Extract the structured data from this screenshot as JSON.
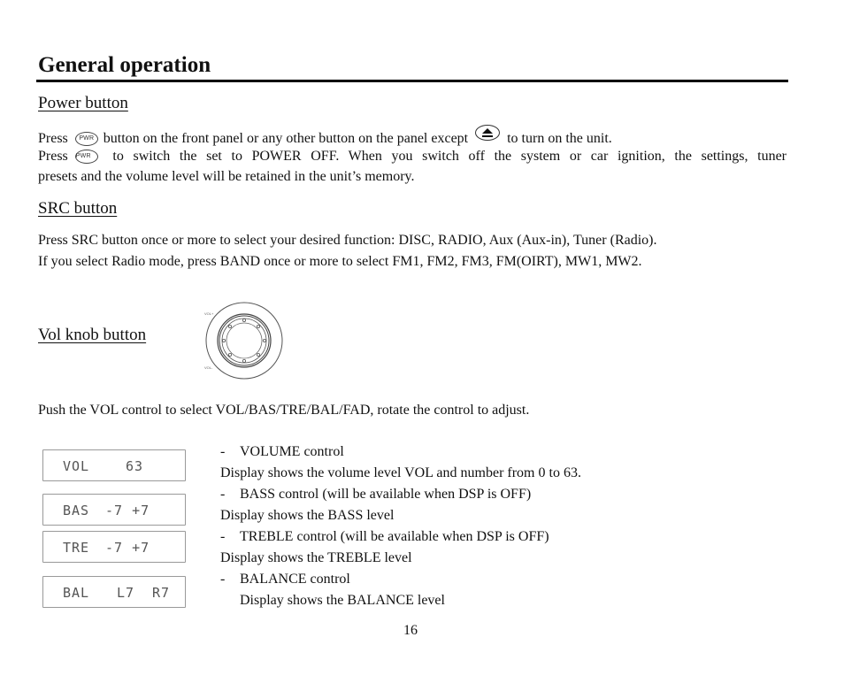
{
  "page": {
    "title": "General operation",
    "page_number": "16"
  },
  "power": {
    "heading": "Power button",
    "line1": {
      "pre": "Press",
      "icon1": "PWR",
      "mid": "button on the front panel or any other button on the panel except",
      "icon2": "eject-icon",
      "post": "to turn on the unit."
    },
    "line2": {
      "pre": "Press",
      "icon": "PWR",
      "post": "to switch the set to POWER OFF. When you switch off the system or car ignition, the settings, tuner"
    },
    "line3": "presets and the volume level will be retained in the unit’s memory."
  },
  "src": {
    "heading": "SRC button",
    "line1": "Press SRC button once or more to select your desired function: DISC, RADIO, Aux (Aux-in), Tuner (Radio).",
    "line2": "If you select Radio mode, press BAND once or more to select FM1, FM2, FM3, FM(OIRT), MW1, MW2."
  },
  "vol": {
    "heading": "Vol knob button",
    "knob_labels": {
      "top": "VOL+",
      "bottom": "VOL-"
    },
    "intro": "Push the VOL control to select VOL/BAS/TRE/BAL/FAD, rotate the control to adjust."
  },
  "displays": [
    {
      "label": "VOL",
      "value": "63"
    },
    {
      "label": "BAS",
      "value": "-7 +7"
    },
    {
      "label": "TRE",
      "value": "-7 +7"
    },
    {
      "label": "BAL",
      "value_left": "L7",
      "value_right": "R7"
    }
  ],
  "descriptions": [
    {
      "dash": "-",
      "text": "VOLUME control"
    },
    {
      "text": "Display shows the volume level VOL and number from 0 to 63."
    },
    {
      "dash": "-",
      "text": "BASS control (will be available when DSP is OFF)"
    },
    {
      "text": "Display shows the BASS level"
    },
    {
      "dash": "-",
      "text": "TREBLE control (will be available when DSP is OFF)"
    },
    {
      "text": "Display shows the TREBLE level"
    },
    {
      "dash": "-",
      "text": "BALANCE control"
    },
    {
      "text": "Display shows the BALANCE level",
      "indented": true
    }
  ]
}
